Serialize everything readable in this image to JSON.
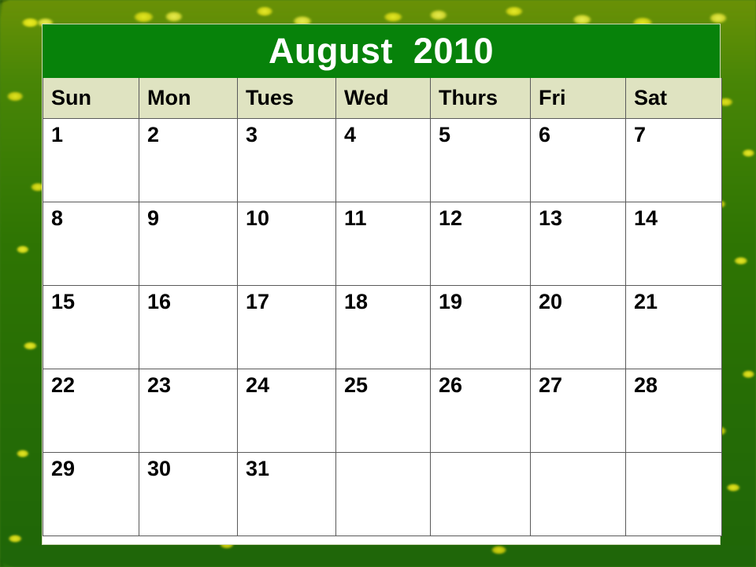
{
  "calendar": {
    "title": "August  2010",
    "month": "August",
    "year": "2010",
    "weekday_headers": [
      "Sun",
      "Mon",
      "Tues",
      "Wed",
      "Thurs",
      "Fri",
      "Sat"
    ],
    "weeks": [
      [
        "1",
        "2",
        "3",
        "4",
        "5",
        "6",
        "7"
      ],
      [
        "8",
        "9",
        "10",
        "11",
        "12",
        "13",
        "14"
      ],
      [
        "15",
        "16",
        "17",
        "18",
        "19",
        "20",
        "21"
      ],
      [
        "22",
        "23",
        "24",
        "25",
        "26",
        "27",
        "28"
      ],
      [
        "29",
        "30",
        "31",
        "",
        "",
        "",
        ""
      ]
    ],
    "colors": {
      "title_background": "#07820a",
      "title_text": "#ffffff",
      "weekday_header_background": "#dfe3c1",
      "cell_background": "#ffffff",
      "grid_line": "#5a5a5a",
      "text": "#000000"
    }
  },
  "background": {
    "description": "yellow-flowering-foliage-photo",
    "dominant_colors": [
      "#2f6b12",
      "#d8dc2e",
      "#6d8f16"
    ]
  }
}
